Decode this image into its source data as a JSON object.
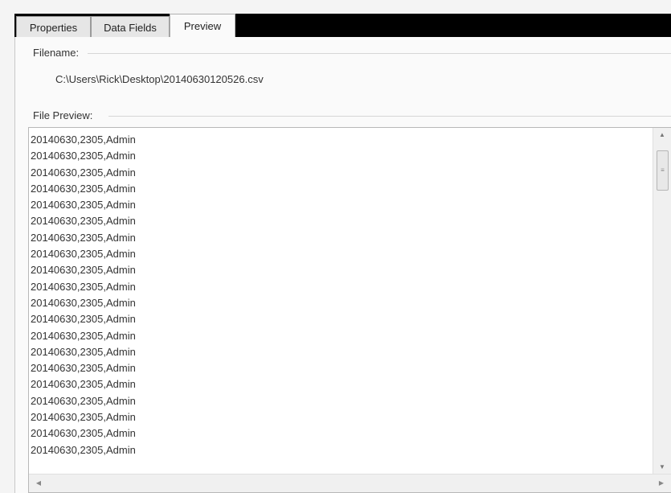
{
  "tabs": [
    "Properties",
    "Data Fields",
    "Preview"
  ],
  "filename": {
    "label": "Filename:",
    "value": "C:\\Users\\Rick\\Desktop\\20140630120526.csv"
  },
  "preview": {
    "label": "File Preview:",
    "lines": [
      "20140630,2305,Admin",
      "20140630,2305,Admin",
      "20140630,2305,Admin",
      "20140630,2305,Admin",
      "20140630,2305,Admin",
      "20140630,2305,Admin",
      "20140630,2305,Admin",
      "20140630,2305,Admin",
      "20140630,2305,Admin",
      "20140630,2305,Admin",
      "20140630,2305,Admin",
      "20140630,2305,Admin",
      "20140630,2305,Admin",
      "20140630,2305,Admin",
      "20140630,2305,Admin",
      "20140630,2305,Admin",
      "20140630,2305,Admin",
      "20140630,2305,Admin",
      "20140630,2305,Admin",
      "20140630,2305,Admin"
    ]
  },
  "icons": {
    "scroll_up": "triangle-up",
    "scroll_down": "triangle-down",
    "scroll_left": "triangle-left",
    "scroll_right": "triangle-right"
  }
}
